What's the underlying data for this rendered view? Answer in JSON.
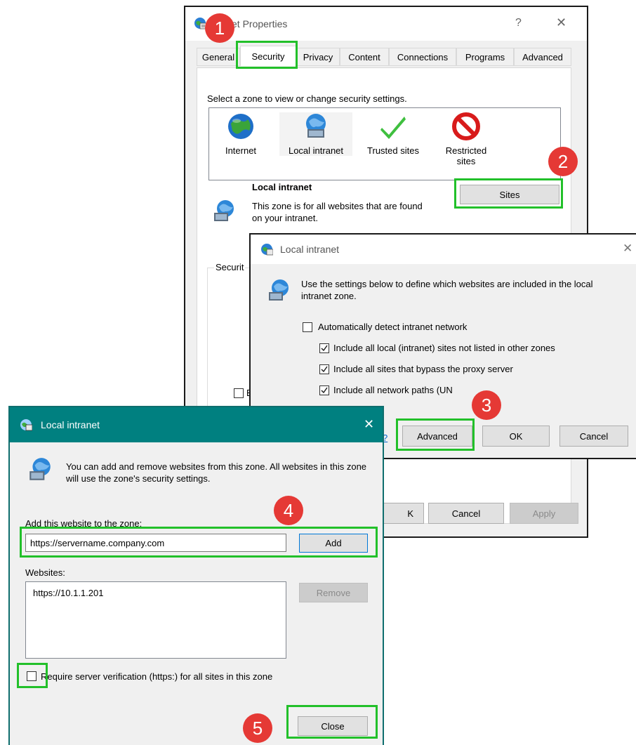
{
  "internet_properties": {
    "title": "et Properties",
    "help": "?",
    "close": "✕",
    "tabs": [
      "General",
      "Security",
      "Privacy",
      "Content",
      "Connections",
      "Programs",
      "Advanced"
    ],
    "zone_prompt": "Select a zone to view or change security settings.",
    "zones": [
      {
        "label": "Internet",
        "icon": "globe-icon"
      },
      {
        "label": "Local intranet",
        "icon": "intranet-globe-icon"
      },
      {
        "label": "Trusted sites",
        "icon": "checkmark-icon"
      },
      {
        "label": "Restricted sites",
        "label_line1": "Restricted",
        "label_line2": "sites",
        "icon": "no-entry-icon"
      }
    ],
    "zone_title": "Local intranet",
    "zone_desc": "This zone is for all websites that are found on your intranet.",
    "sites_button": "Sites",
    "security_group_label": "Securit",
    "checkbox_partial": "E",
    "bottom_buttons": {
      "ok_partial": "K",
      "cancel": "Cancel",
      "apply": "Apply"
    }
  },
  "intranet_dialog": {
    "title": "Local intranet",
    "close": "✕",
    "description": "Use the settings below to define which websites are included in the local intranet zone.",
    "options": [
      {
        "label": "Automatically detect intranet network",
        "checked": false
      },
      {
        "label": "Include all local (intranet) sites not listed in other zones",
        "checked": true
      },
      {
        "label": "Include all sites that bypass the proxy server",
        "checked": true
      },
      {
        "label": "Include all network paths (UN",
        "checked": true
      }
    ],
    "link_partial": "?",
    "advanced_button": "Advanced",
    "ok_button": "OK",
    "cancel_button": "Cancel"
  },
  "sites_dialog": {
    "title": "Local intranet",
    "close": "✕",
    "description": "You can add and remove websites from this zone. All websites in this zone will use the zone's security settings.",
    "add_label": "Add this website to the zone:",
    "add_value": "https://servername.company.com",
    "add_button": "Add",
    "websites_label": "Websites:",
    "websites": [
      "https://10.1.1.201"
    ],
    "remove_button": "Remove",
    "require_https_label": "Require server verification (https:) for all sites in this zone",
    "require_https_checked": false,
    "close_button": "Close"
  },
  "annotations": {
    "badges": [
      "1",
      "2",
      "3",
      "4",
      "5"
    ],
    "highlight_color": "#22c02a",
    "badge_color": "#e53935"
  },
  "colors": {
    "titlebar_teal": "#008080",
    "dialog_bg": "#f0f0f0",
    "focus_blue": "#0078d7"
  }
}
